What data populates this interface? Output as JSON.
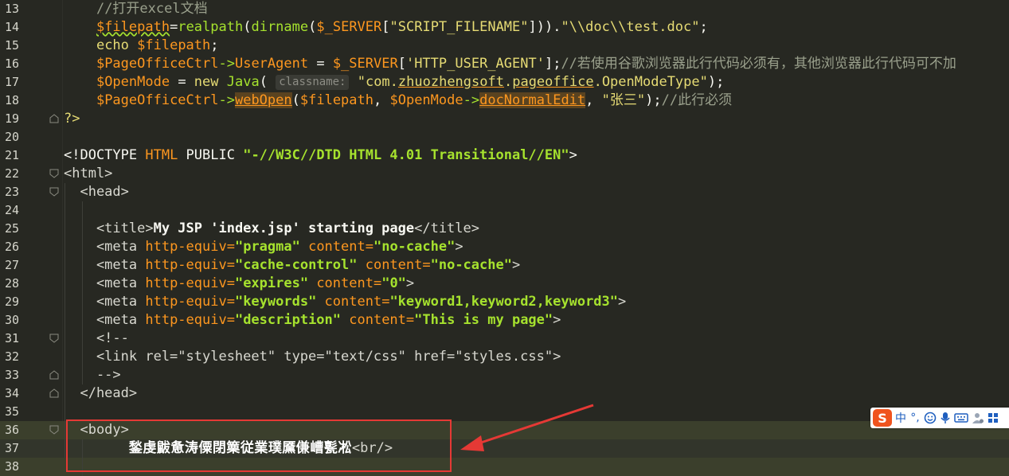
{
  "editor": {
    "lines": [
      {
        "num": "13",
        "segs": [
          {
            "t": "    ",
            "c": ""
          },
          {
            "t": "//打开excel文档",
            "c": "cm"
          }
        ]
      },
      {
        "num": "14",
        "segs": [
          {
            "t": "    ",
            "c": ""
          },
          {
            "t": "$filepath",
            "c": "var squig"
          },
          {
            "t": "=",
            "c": ""
          },
          {
            "t": "realpath",
            "c": "fn"
          },
          {
            "t": "(",
            "c": ""
          },
          {
            "t": "dirname",
            "c": "fn"
          },
          {
            "t": "(",
            "c": ""
          },
          {
            "t": "$_SERVER",
            "c": "var"
          },
          {
            "t": "[",
            "c": ""
          },
          {
            "t": "\"SCRIPT_FILENAME\"",
            "c": "str"
          },
          {
            "t": "])).",
            "c": ""
          },
          {
            "t": "\"\\\\doc\\\\test.doc\"",
            "c": "str"
          },
          {
            "t": ";",
            "c": ""
          }
        ]
      },
      {
        "num": "15",
        "segs": [
          {
            "t": "    ",
            "c": ""
          },
          {
            "t": "echo ",
            "c": "str"
          },
          {
            "t": "$filepath",
            "c": "var"
          },
          {
            "t": ";",
            "c": ""
          }
        ]
      },
      {
        "num": "16",
        "segs": [
          {
            "t": "    ",
            "c": ""
          },
          {
            "t": "$PageOfficeCtrl",
            "c": "var"
          },
          {
            "t": "->",
            "c": "fn"
          },
          {
            "t": "UserAgent",
            "c": "var"
          },
          {
            "t": " = ",
            "c": ""
          },
          {
            "t": "$_SERVER",
            "c": "var"
          },
          {
            "t": "[",
            "c": ""
          },
          {
            "t": "'HTTP_USER_AGENT'",
            "c": "str"
          },
          {
            "t": "];",
            "c": ""
          },
          {
            "t": "//若使用谷歌浏览器此行代码必须有，其他浏览器此行代码可不加",
            "c": "cm"
          }
        ]
      },
      {
        "num": "17",
        "segs": [
          {
            "t": "    ",
            "c": ""
          },
          {
            "t": "$OpenMode",
            "c": "var"
          },
          {
            "t": " = ",
            "c": ""
          },
          {
            "t": "new ",
            "c": "str"
          },
          {
            "t": "Java",
            "c": "fn"
          },
          {
            "t": "( ",
            "c": ""
          },
          {
            "t": "classname:",
            "c": "hint"
          },
          {
            "t": " \"com.",
            "c": "str"
          },
          {
            "t": "zhuozhengsoft",
            "c": "str u"
          },
          {
            "t": ".",
            "c": "str"
          },
          {
            "t": "pageoffice",
            "c": "str u"
          },
          {
            "t": ".OpenModeType\"",
            "c": "str"
          },
          {
            "t": ");",
            "c": ""
          }
        ]
      },
      {
        "num": "18",
        "segs": [
          {
            "t": "    ",
            "c": ""
          },
          {
            "t": "$PageOfficeCtrl",
            "c": "var"
          },
          {
            "t": "->",
            "c": "fn"
          },
          {
            "t": "webOpen",
            "c": "var hlbox"
          },
          {
            "t": "(",
            "c": ""
          },
          {
            "t": "$filepath",
            "c": "var"
          },
          {
            "t": ", ",
            "c": ""
          },
          {
            "t": "$OpenMode",
            "c": "var"
          },
          {
            "t": "->",
            "c": "fn"
          },
          {
            "t": "docNormalEdit",
            "c": "var hlbox"
          },
          {
            "t": ", ",
            "c": ""
          },
          {
            "t": "\"张三\"",
            "c": "str"
          },
          {
            "t": ");",
            "c": ""
          },
          {
            "t": "//此行必须",
            "c": "cm"
          }
        ]
      },
      {
        "num": "19",
        "segs": [
          {
            "t": "?>",
            "c": "str"
          }
        ]
      },
      {
        "num": "20",
        "segs": []
      },
      {
        "num": "21",
        "segs": [
          {
            "t": "<!DOCTYPE ",
            "c": "tag"
          },
          {
            "t": "HTML ",
            "c": "attr"
          },
          {
            "t": "PUBLIC ",
            "c": "tag"
          },
          {
            "t": "\"-//W3C//DTD HTML 4.01 Transitional//EN\"",
            "c": "str b"
          },
          {
            "t": ">",
            "c": "tag"
          }
        ]
      },
      {
        "num": "22",
        "segs": [
          {
            "t": "<html>",
            "c": "tagn"
          }
        ]
      },
      {
        "num": "23",
        "segs": [
          {
            "t": "  <head>",
            "c": "tagn"
          }
        ]
      },
      {
        "num": "24",
        "segs": []
      },
      {
        "num": "25",
        "segs": [
          {
            "t": "    <title>",
            "c": "tagn"
          },
          {
            "t": "My JSP 'index.jsp' starting page",
            "c": "kw bold"
          },
          {
            "t": "</title>",
            "c": "tagn"
          }
        ]
      },
      {
        "num": "26",
        "segs": [
          {
            "t": "    <meta ",
            "c": "tagn"
          },
          {
            "t": "http-equiv=",
            "c": "attr"
          },
          {
            "t": "\"pragma\"",
            "c": "str b"
          },
          {
            "t": " content=",
            "c": "attr"
          },
          {
            "t": "\"no-cache\"",
            "c": "str b"
          },
          {
            "t": ">",
            "c": "tagn"
          }
        ]
      },
      {
        "num": "27",
        "segs": [
          {
            "t": "    <meta ",
            "c": "tagn"
          },
          {
            "t": "http-equiv=",
            "c": "attr"
          },
          {
            "t": "\"cache-control\"",
            "c": "str b"
          },
          {
            "t": " content=",
            "c": "attr"
          },
          {
            "t": "\"no-cache\"",
            "c": "str b"
          },
          {
            "t": ">",
            "c": "tagn"
          }
        ]
      },
      {
        "num": "28",
        "segs": [
          {
            "t": "    <meta ",
            "c": "tagn"
          },
          {
            "t": "http-equiv=",
            "c": "attr"
          },
          {
            "t": "\"expires\"",
            "c": "str b"
          },
          {
            "t": " content=",
            "c": "attr"
          },
          {
            "t": "\"0\"",
            "c": "str b"
          },
          {
            "t": ">",
            "c": "tagn"
          }
        ]
      },
      {
        "num": "29",
        "segs": [
          {
            "t": "    <meta ",
            "c": "tagn"
          },
          {
            "t": "http-equiv=",
            "c": "attr"
          },
          {
            "t": "\"keywords\"",
            "c": "str b"
          },
          {
            "t": " content=",
            "c": "attr"
          },
          {
            "t": "\"keyword1,keyword2,keyword3\"",
            "c": "str b"
          },
          {
            "t": ">",
            "c": "tagn"
          }
        ]
      },
      {
        "num": "30",
        "segs": [
          {
            "t": "    <meta ",
            "c": "tagn"
          },
          {
            "t": "http-equiv=",
            "c": "attr"
          },
          {
            "t": "\"description\"",
            "c": "str b"
          },
          {
            "t": " content=",
            "c": "attr"
          },
          {
            "t": "\"This is my page\"",
            "c": "str b"
          },
          {
            "t": ">",
            "c": "tagn"
          }
        ]
      },
      {
        "num": "31",
        "segs": [
          {
            "t": "    <!--",
            "c": "tagn"
          }
        ]
      },
      {
        "num": "32",
        "segs": [
          {
            "t": "    <link rel=\"stylesheet\" type=\"text/css\" href=\"styles.css\">",
            "c": "tagn"
          }
        ]
      },
      {
        "num": "33",
        "segs": [
          {
            "t": "    -->",
            "c": "tagn"
          }
        ]
      },
      {
        "num": "34",
        "segs": [
          {
            "t": "  </head>",
            "c": "tagn"
          }
        ]
      },
      {
        "num": "35",
        "segs": []
      },
      {
        "num": "36",
        "segs": [
          {
            "t": "  <body>",
            "c": "tagn"
          }
        ]
      },
      {
        "num": "37",
        "segs": [
          {
            "t": "        ",
            "c": ""
          },
          {
            "t": "鍫虔鼥惫涛僳閉篥従業璞黡傔嶆甏凇",
            "c": "garbled"
          },
          {
            "t": "<br/>",
            "c": "tagn"
          }
        ]
      },
      {
        "num": "38",
        "segs": []
      }
    ]
  },
  "ime_toolbar": {
    "logo": "S",
    "mode": "中",
    "punct": "°,",
    "items": [
      "emoji-icon",
      "microphone-icon",
      "keyboard-icon",
      "user-icon",
      "grid-icon"
    ]
  },
  "colors": {
    "background": "#272822",
    "annotation_red": "#e53935",
    "ime_orange": "#f0541e"
  }
}
